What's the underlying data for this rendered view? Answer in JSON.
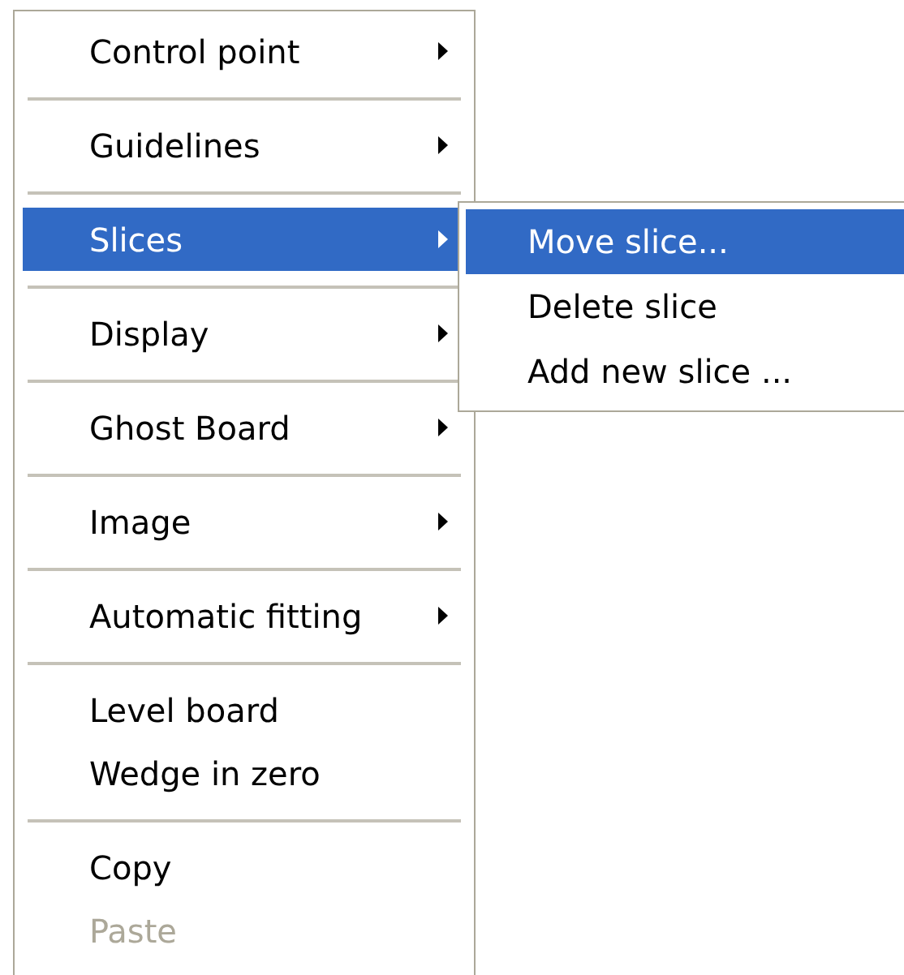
{
  "menu": {
    "items": [
      {
        "kind": "item",
        "label": "Control point",
        "has_submenu": true,
        "selected": false,
        "disabled": false
      },
      {
        "kind": "separator"
      },
      {
        "kind": "item",
        "label": "Guidelines",
        "has_submenu": true,
        "selected": false,
        "disabled": false
      },
      {
        "kind": "separator"
      },
      {
        "kind": "item",
        "label": "Slices",
        "has_submenu": true,
        "selected": true,
        "disabled": false
      },
      {
        "kind": "separator"
      },
      {
        "kind": "item",
        "label": "Display",
        "has_submenu": true,
        "selected": false,
        "disabled": false
      },
      {
        "kind": "separator"
      },
      {
        "kind": "item",
        "label": "Ghost Board",
        "has_submenu": true,
        "selected": false,
        "disabled": false
      },
      {
        "kind": "separator"
      },
      {
        "kind": "item",
        "label": "Image",
        "has_submenu": true,
        "selected": false,
        "disabled": false
      },
      {
        "kind": "separator"
      },
      {
        "kind": "item",
        "label": "Automatic fitting",
        "has_submenu": true,
        "selected": false,
        "disabled": false
      },
      {
        "kind": "separator"
      },
      {
        "kind": "item",
        "label": "Level board",
        "has_submenu": false,
        "selected": false,
        "disabled": false
      },
      {
        "kind": "item",
        "label": "Wedge in zero",
        "has_submenu": false,
        "selected": false,
        "disabled": false
      },
      {
        "kind": "separator"
      },
      {
        "kind": "item",
        "label": "Copy",
        "has_submenu": false,
        "selected": false,
        "disabled": false
      },
      {
        "kind": "item",
        "label": "Paste",
        "has_submenu": false,
        "selected": false,
        "disabled": true
      }
    ]
  },
  "submenu": {
    "items": [
      {
        "label": "Move slice...",
        "selected": true,
        "disabled": false
      },
      {
        "label": "Delete slice",
        "selected": false,
        "disabled": false
      },
      {
        "label": "Add new slice ...",
        "selected": false,
        "disabled": false
      }
    ]
  }
}
